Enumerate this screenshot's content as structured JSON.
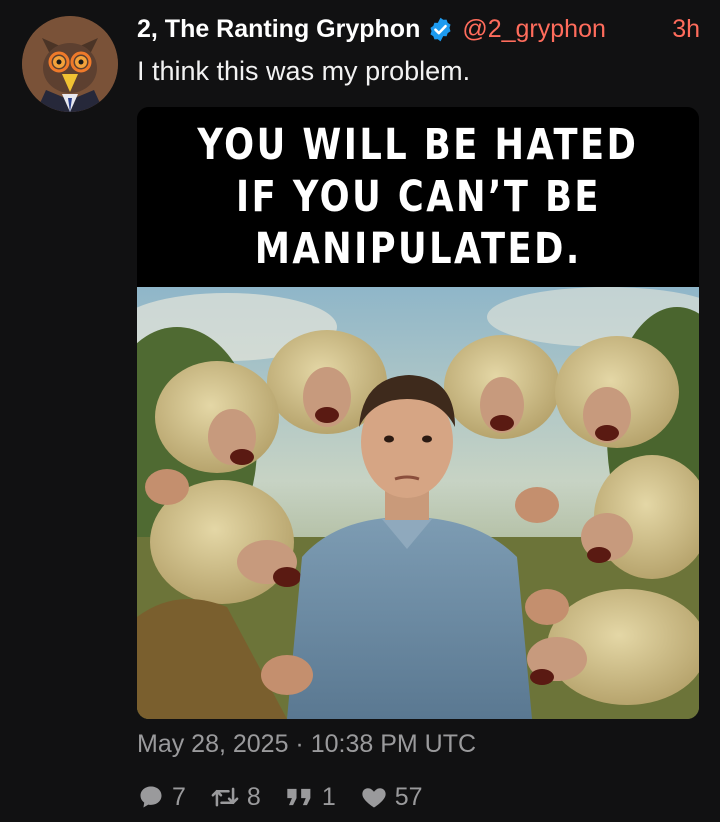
{
  "post": {
    "author_name": "2, The Ranting Gryphon",
    "handle": "@2_gryphon",
    "relative_time": "3h",
    "text": "I think this was my problem.",
    "timestamp": "May 28, 2025 · 10:38 PM UTC"
  },
  "media": {
    "caption_lines": [
      "YOU WILL BE HATED",
      "IF YOU CAN’T BE",
      "MANIPULATED."
    ]
  },
  "stats": {
    "replies": "7",
    "reposts": "8",
    "quotes": "1",
    "likes": "57"
  },
  "icons": {
    "verified": "verified-badge-icon",
    "reply": "reply-bubble-icon",
    "repost": "repost-arrows-icon",
    "quote": "quote-icon",
    "like": "heart-icon"
  },
  "colors": {
    "background": "#111112",
    "accent": "#ff6c5c",
    "verified": "#1d9bf0",
    "muted": "#9a9a9c"
  }
}
